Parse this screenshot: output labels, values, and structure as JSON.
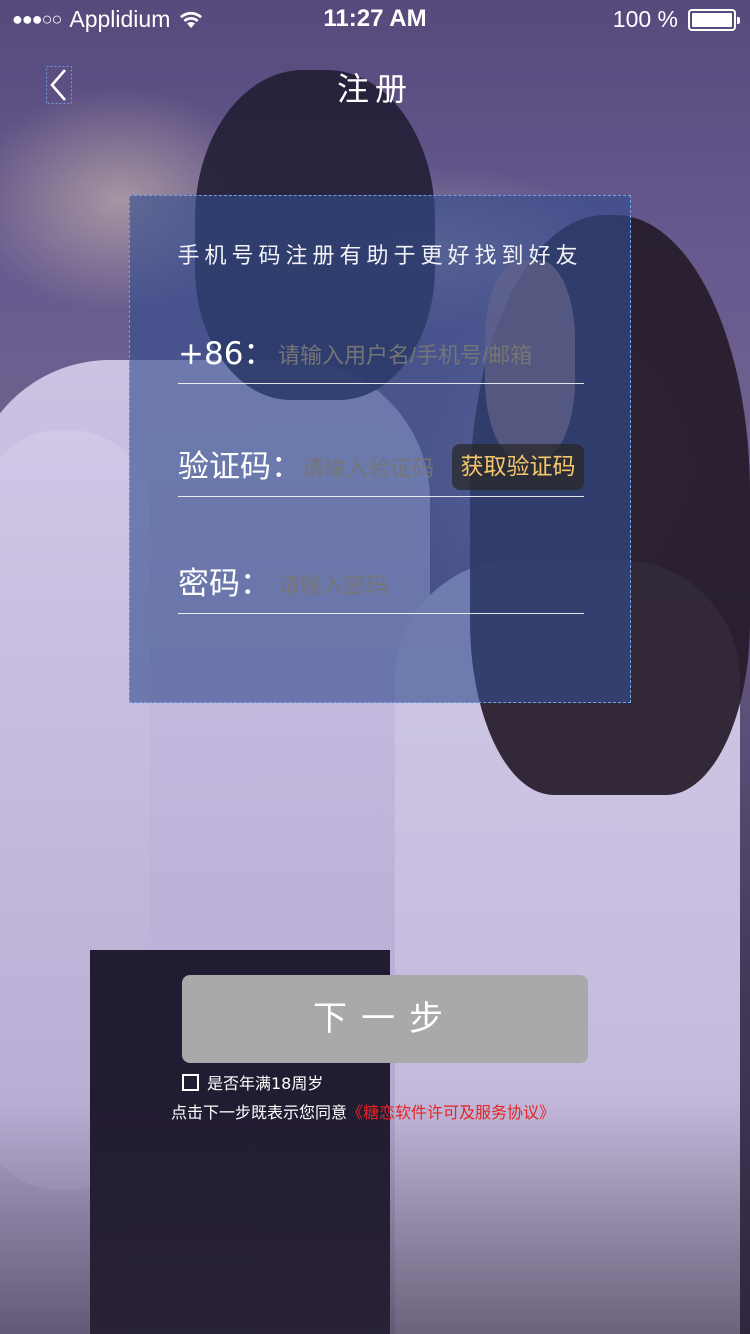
{
  "status_bar": {
    "carrier": "Applidium",
    "signal_dots": "●●●○○",
    "time": "11:27 AM",
    "battery": "100 %"
  },
  "nav": {
    "title": "注册",
    "back_icon": "chevron-left-icon"
  },
  "form": {
    "subtitle": "手机号码注册有助于更好找到好友",
    "phone": {
      "label": "+86：",
      "placeholder": "请输入用户名/手机号/邮箱"
    },
    "code": {
      "label": "验证码：",
      "placeholder": "请输入验证码",
      "button": "获取验证码"
    },
    "password": {
      "label": "密码：",
      "placeholder": "请输入密码"
    }
  },
  "next_button": "下一步",
  "age_check": {
    "label": "是否年满18周岁",
    "checked": false
  },
  "agreement": {
    "prefix": "点击下一步既表示您同意",
    "link": "《糖恋软件许可及服务协议》"
  },
  "colors": {
    "panel_bg": "#344e8c",
    "code_button_text": "#f5c66a",
    "link_red": "#e52424",
    "next_button_bg": "#a9a9a9"
  }
}
